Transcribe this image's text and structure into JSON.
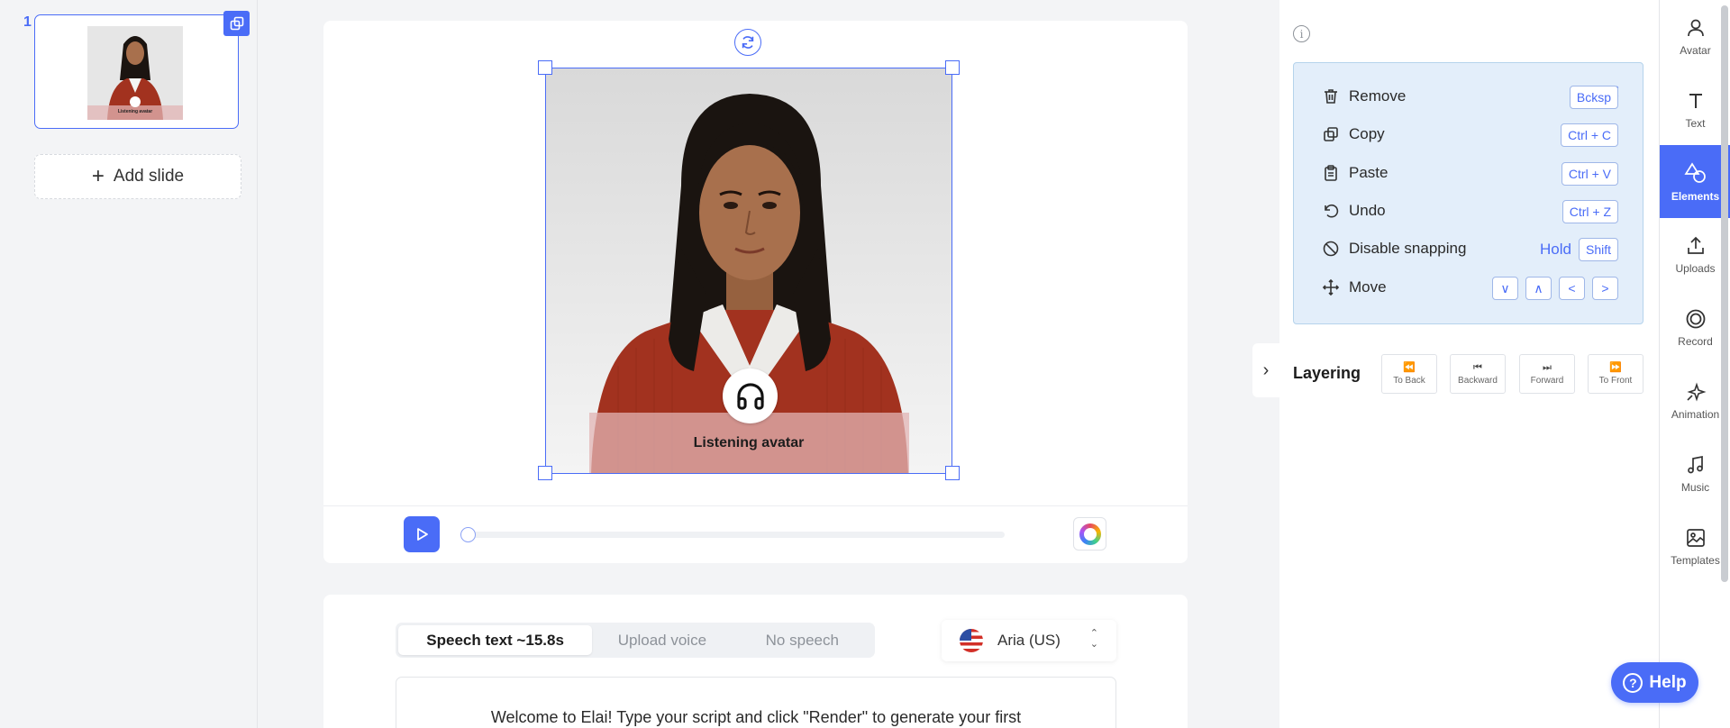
{
  "slides": {
    "items": [
      {
        "number": "1",
        "thumb_label": "Listening avatar"
      }
    ],
    "add_slide_label": "Add slide"
  },
  "canvas": {
    "avatar_overlay_label": "Listening avatar"
  },
  "player": {
    "progress": 0
  },
  "speech": {
    "tabs": [
      {
        "label": "Speech text ~15.8s",
        "active": true
      },
      {
        "label": "Upload voice",
        "active": false
      },
      {
        "label": "No speech",
        "active": false
      }
    ],
    "voice": "Aria (US)",
    "text": "Welcome to Elai! Type your script and click \"Render\" to generate your first"
  },
  "shortcuts": {
    "items": [
      {
        "icon": "trash-icon",
        "label": "Remove",
        "keys": [
          "Bcksp"
        ]
      },
      {
        "icon": "copy-icon",
        "label": "Copy",
        "keys": [
          "Ctrl + C"
        ]
      },
      {
        "icon": "clipboard-icon",
        "label": "Paste",
        "keys": [
          "Ctrl + V"
        ]
      },
      {
        "icon": "undo-icon",
        "label": "Undo",
        "keys": [
          "Ctrl + Z"
        ]
      },
      {
        "icon": "no-snap-icon",
        "label": "Disable snapping",
        "hold": "Hold",
        "keys": [
          "Shift"
        ]
      },
      {
        "icon": "move-icon",
        "label": "Move",
        "keys": [
          "∨",
          "∧",
          "<",
          ">"
        ]
      }
    ]
  },
  "layering": {
    "title": "Layering",
    "buttons": [
      {
        "icon": "⏪",
        "label": "To Back"
      },
      {
        "icon": "⏮",
        "label": "Backward"
      },
      {
        "icon": "⏭",
        "label": "Forward"
      },
      {
        "icon": "⏩",
        "label": "To Front"
      }
    ]
  },
  "nav": {
    "items": [
      {
        "icon": "avatar-icon",
        "label": "Avatar",
        "active": false
      },
      {
        "icon": "text-icon",
        "label": "Text",
        "active": false
      },
      {
        "icon": "elements-icon",
        "label": "Elements",
        "active": true
      },
      {
        "icon": "upload-icon",
        "label": "Uploads",
        "active": false
      },
      {
        "icon": "record-icon",
        "label": "Record",
        "active": false
      },
      {
        "icon": "animation-icon",
        "label": "Animation",
        "active": false
      },
      {
        "icon": "music-icon",
        "label": "Music",
        "active": false
      },
      {
        "icon": "templates-icon",
        "label": "Templates",
        "active": false
      }
    ]
  },
  "help": {
    "label": "Help",
    "icon": "?"
  },
  "colors": {
    "accent": "#4a6cf7",
    "shortcut_bg": "#e3eefa",
    "sweater": "#a2321f"
  }
}
